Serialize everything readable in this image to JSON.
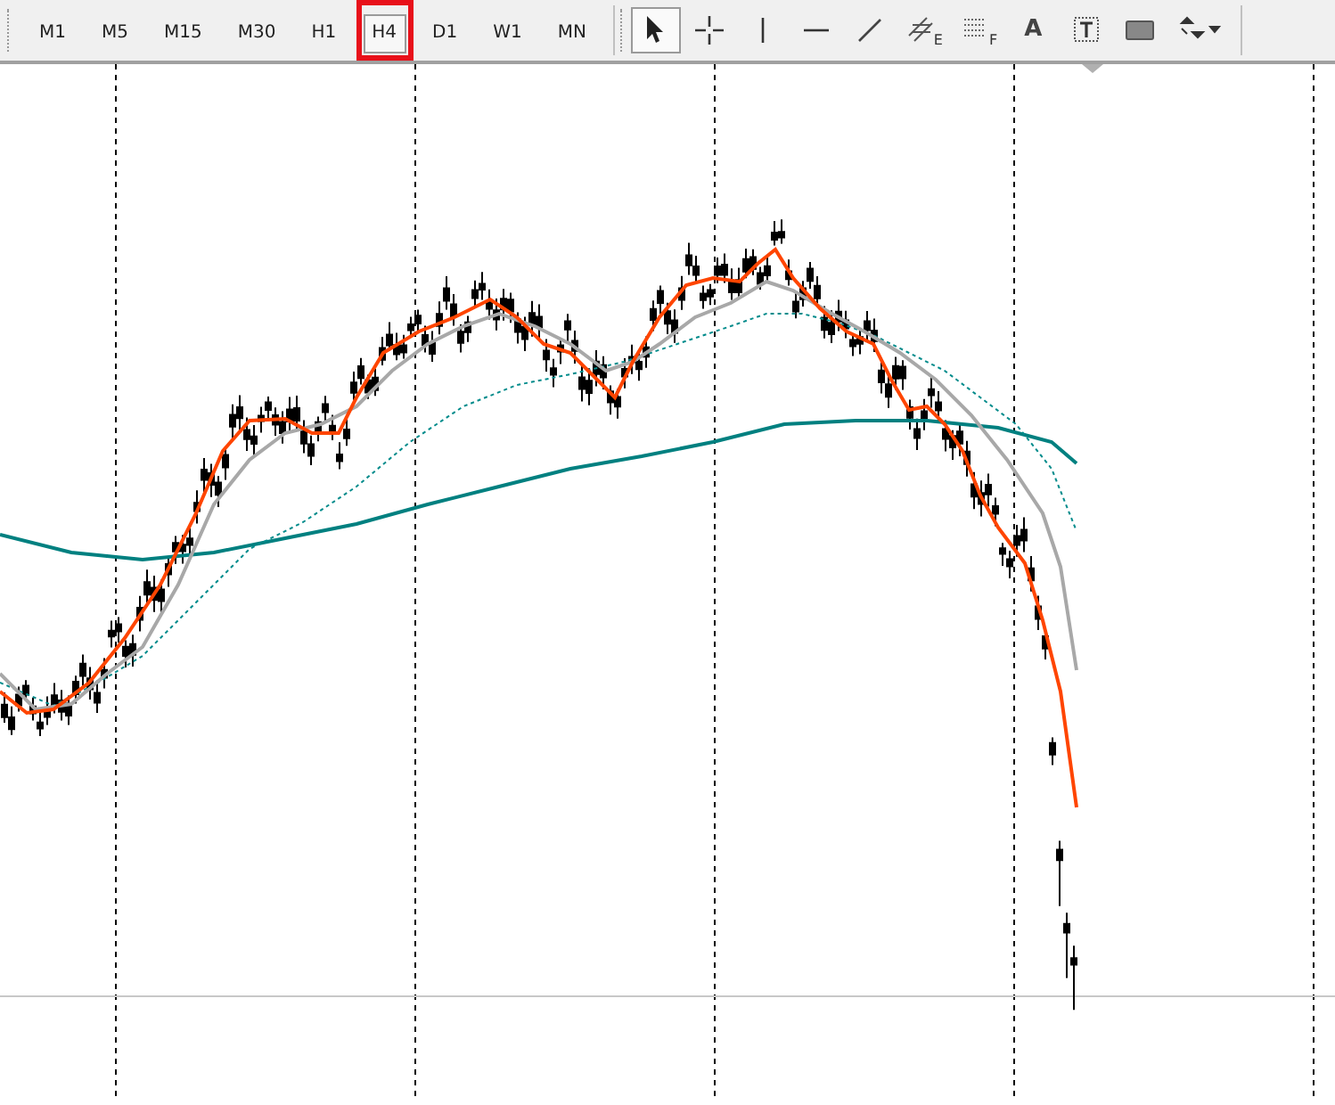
{
  "timeframes": [
    {
      "label": "M1",
      "selected": false,
      "highlighted": false
    },
    {
      "label": "M5",
      "selected": false,
      "highlighted": false
    },
    {
      "label": "M15",
      "selected": false,
      "highlighted": false
    },
    {
      "label": "M30",
      "selected": false,
      "highlighted": false
    },
    {
      "label": "H1",
      "selected": false,
      "highlighted": false
    },
    {
      "label": "H4",
      "selected": true,
      "highlighted": true
    },
    {
      "label": "D1",
      "selected": false,
      "highlighted": false
    },
    {
      "label": "W1",
      "selected": false,
      "highlighted": false
    },
    {
      "label": "MN",
      "selected": false,
      "highlighted": false
    }
  ],
  "tools": [
    {
      "kind": "cursor",
      "selected": true
    },
    {
      "kind": "crosshair",
      "selected": false
    },
    {
      "kind": "vline",
      "selected": false
    },
    {
      "kind": "hline",
      "selected": false
    },
    {
      "kind": "trendline",
      "selected": false
    },
    {
      "kind": "channel",
      "selected": false,
      "sub": "E"
    },
    {
      "kind": "fibo",
      "selected": false,
      "sub": "F"
    },
    {
      "kind": "text",
      "selected": false,
      "glyph": "A"
    },
    {
      "kind": "label",
      "selected": false
    },
    {
      "kind": "rectangle",
      "selected": false
    },
    {
      "kind": "arrows",
      "selected": false
    }
  ]
}
